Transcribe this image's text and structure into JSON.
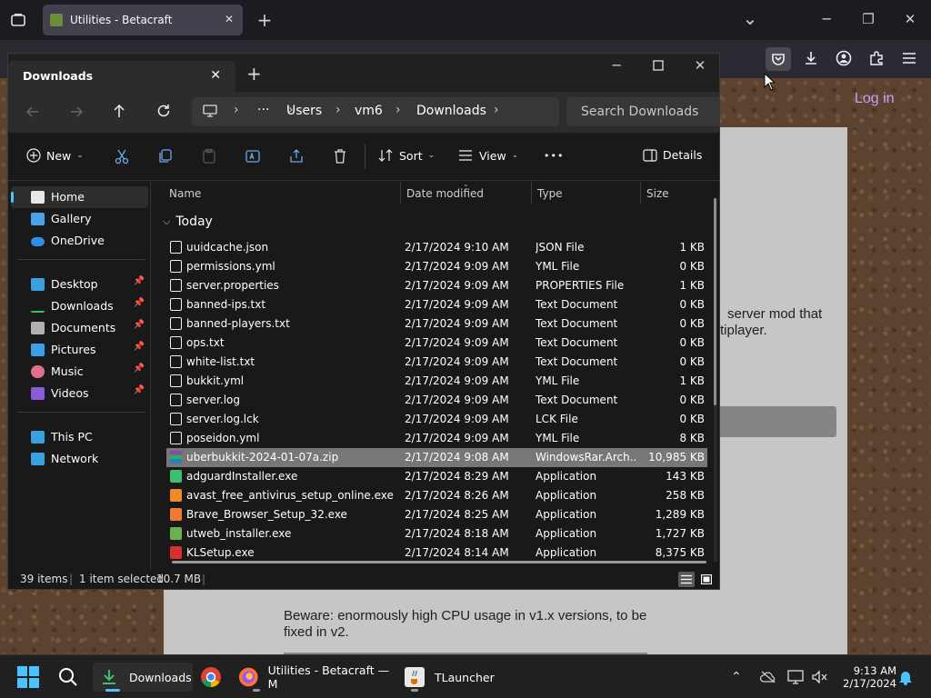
{
  "browser": {
    "tab_title": "Utilities - Betacraft",
    "new_tab": "+",
    "minimize": "─",
    "maximize": "❐",
    "close": "✕",
    "list_all_tabs": "⌄"
  },
  "webpage": {
    "login": "Log in",
    "desc_line1": "server mod that",
    "desc_line2": "tiplayer.",
    "beware": "Beware: enormously high CPU usage in v1.x versions, to be fixed in v2."
  },
  "explorer": {
    "tab_title": "Downloads",
    "tab_close": "✕",
    "new_tab": "+",
    "breadcrumb": [
      "Users",
      "vm6",
      "Downloads"
    ],
    "ellipsis": "···",
    "search_placeholder": "Search Downloads",
    "toolbar": {
      "new": "New",
      "sort": "Sort",
      "view": "View",
      "more": "•••",
      "details": "Details"
    },
    "sidebar": {
      "home": "Home",
      "gallery": "Gallery",
      "onedrive": "OneDrive",
      "desktop": "Desktop",
      "downloads": "Downloads",
      "documents": "Documents",
      "pictures": "Pictures",
      "music": "Music",
      "videos": "Videos",
      "thispc": "This PC",
      "network": "Network"
    },
    "columns": {
      "name": "Name",
      "date": "Date modified",
      "type": "Type",
      "size": "Size"
    },
    "group": "Today",
    "files": [
      {
        "name": "uuidcache.json",
        "date": "2/17/2024 9:10 AM",
        "type": "JSON File",
        "size": "1 KB"
      },
      {
        "name": "permissions.yml",
        "date": "2/17/2024 9:09 AM",
        "type": "YML File",
        "size": "0 KB"
      },
      {
        "name": "server.properties",
        "date": "2/17/2024 9:09 AM",
        "type": "PROPERTIES File",
        "size": "1 KB"
      },
      {
        "name": "banned-ips.txt",
        "date": "2/17/2024 9:09 AM",
        "type": "Text Document",
        "size": "0 KB"
      },
      {
        "name": "banned-players.txt",
        "date": "2/17/2024 9:09 AM",
        "type": "Text Document",
        "size": "0 KB"
      },
      {
        "name": "ops.txt",
        "date": "2/17/2024 9:09 AM",
        "type": "Text Document",
        "size": "0 KB"
      },
      {
        "name": "white-list.txt",
        "date": "2/17/2024 9:09 AM",
        "type": "Text Document",
        "size": "0 KB"
      },
      {
        "name": "bukkit.yml",
        "date": "2/17/2024 9:09 AM",
        "type": "YML File",
        "size": "1 KB"
      },
      {
        "name": "server.log",
        "date": "2/17/2024 9:09 AM",
        "type": "Text Document",
        "size": "0 KB"
      },
      {
        "name": "server.log.lck",
        "date": "2/17/2024 9:09 AM",
        "type": "LCK File",
        "size": "0 KB"
      },
      {
        "name": "poseidon.yml",
        "date": "2/17/2024 9:09 AM",
        "type": "YML File",
        "size": "8 KB"
      },
      {
        "name": "uberbukkit-2024-01-07a.zip",
        "date": "2/17/2024 9:08 AM",
        "type": "WindowsRar.Arch...",
        "size": "10,985 KB"
      },
      {
        "name": "adguardInstaller.exe",
        "date": "2/17/2024 8:29 AM",
        "type": "Application",
        "size": "143 KB"
      },
      {
        "name": "avast_free_antivirus_setup_online.exe",
        "date": "2/17/2024 8:26 AM",
        "type": "Application",
        "size": "258 KB"
      },
      {
        "name": "Brave_Browser_Setup_32.exe",
        "date": "2/17/2024 8:25 AM",
        "type": "Application",
        "size": "1,289 KB"
      },
      {
        "name": "utweb_installer.exe",
        "date": "2/17/2024 8:18 AM",
        "type": "Application",
        "size": "1,727 KB"
      },
      {
        "name": "KLSetup.exe",
        "date": "2/17/2024 8:14 AM",
        "type": "Application",
        "size": "8,375 KB"
      }
    ],
    "status": {
      "items": "39 items",
      "selected": "1 item selected",
      "size": "10.7 MB"
    }
  },
  "taskbar": {
    "explorer_label": "Downloads",
    "firefox_label": "Utilities - Betacraft — M",
    "tlauncher_label": "TLauncher",
    "time": "9:13 AM",
    "date": "2/17/2024"
  }
}
